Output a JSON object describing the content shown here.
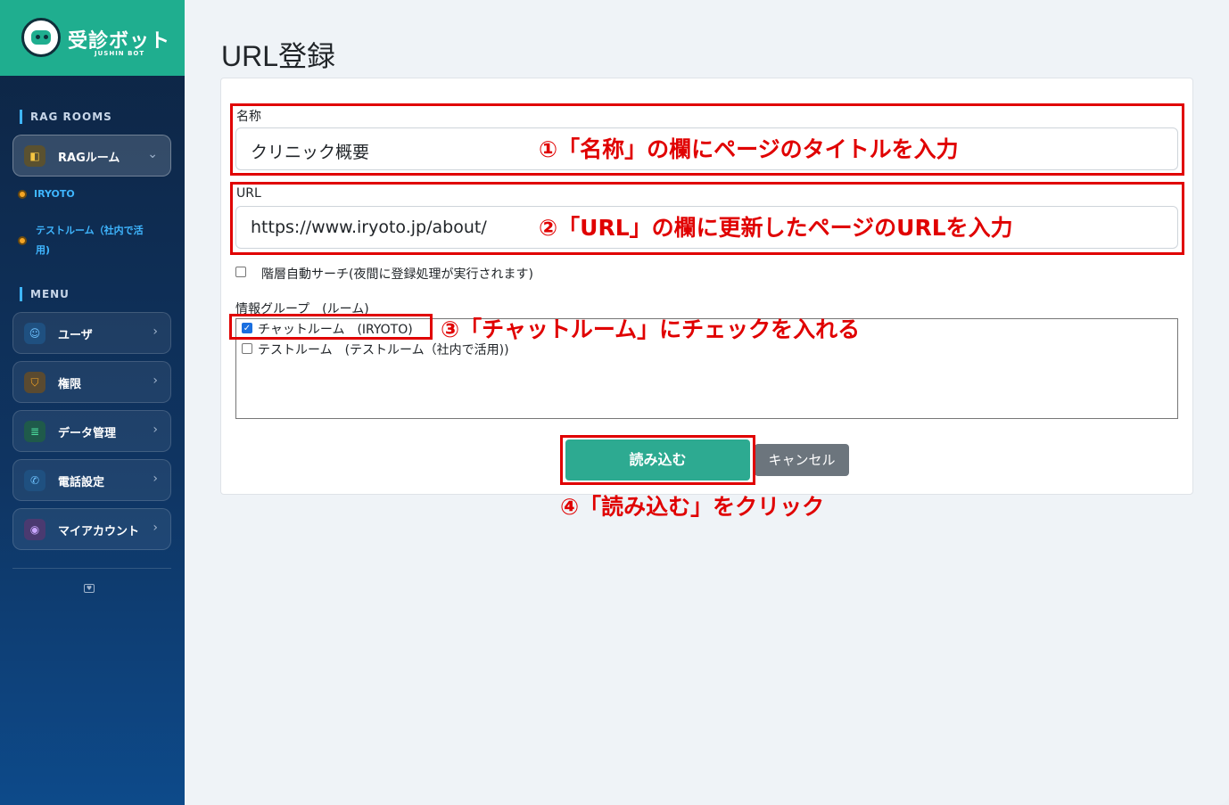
{
  "brand": {
    "name": "受診ボット",
    "sub": "JUSHIN BOT"
  },
  "sidebar": {
    "rag_section": "RAG ROOMS",
    "rag_dropdown": "RAGルーム",
    "rooms": [
      "IRYOTO",
      "テストルーム（社内で活",
      "用)"
    ],
    "menu_section": "MENU",
    "menu_items": [
      "ユーザ",
      "権限",
      "データ管理",
      "電話設定",
      "マイアカウント"
    ]
  },
  "page": {
    "title": "URL登録"
  },
  "form": {
    "name_label": "名称",
    "name_value": "クリニック概要",
    "url_label": "URL",
    "url_value": "https://www.iryoto.jp/about/",
    "auto_search_label": "階層自動サーチ(夜間に登録処理が実行されます)",
    "group_label": "情報グループ　(ルーム)",
    "group_options": [
      "チャットルーム　(IRYOTO)",
      "テストルーム　(テストルーム（社内で活用))"
    ],
    "submit_label": "読み込む",
    "cancel_label": "キャンセル"
  },
  "annotations": {
    "step1": "①「名称」の欄にページのタイトルを入力",
    "step2": "②「URL」の欄に更新したページのURLを入力",
    "step3": "③「チャットルーム」にチェックを入れる",
    "step4": "④「読み込む」をクリック"
  },
  "colors": {
    "accent": "#2daa91",
    "annotation": "#e00000",
    "sidebar_dark": "#0d2442",
    "brand": "#1fae8f"
  }
}
